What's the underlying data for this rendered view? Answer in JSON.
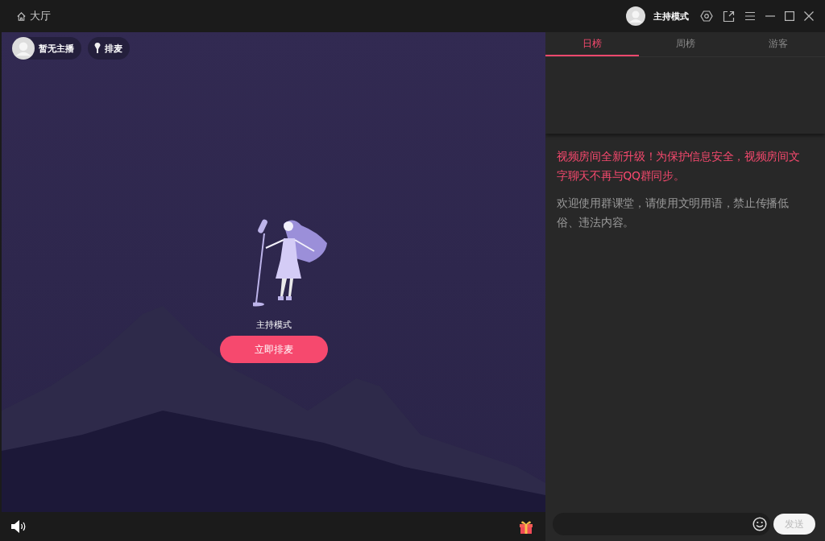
{
  "titlebar": {
    "home_label": "大厅",
    "mode_label": "主持模式"
  },
  "stage": {
    "host_label": "暂无主播",
    "queue_label": "排麦",
    "mode_caption": "主持模式",
    "join_button": "立即排麦"
  },
  "tabs": [
    {
      "label": "日榜",
      "selected": true
    },
    {
      "label": "周榜",
      "selected": false
    },
    {
      "label": "游客",
      "selected": false
    }
  ],
  "messages": [
    {
      "kind": "notice",
      "text": "视频房间全新升级！为保护信息安全，视频房间文字聊天不再与QQ群同步。"
    },
    {
      "kind": "welcome",
      "text": "欢迎使用群课堂，请使用文明用语，禁止传播低俗、违法内容。"
    }
  ],
  "chat_input": {
    "send_button": "发送"
  }
}
